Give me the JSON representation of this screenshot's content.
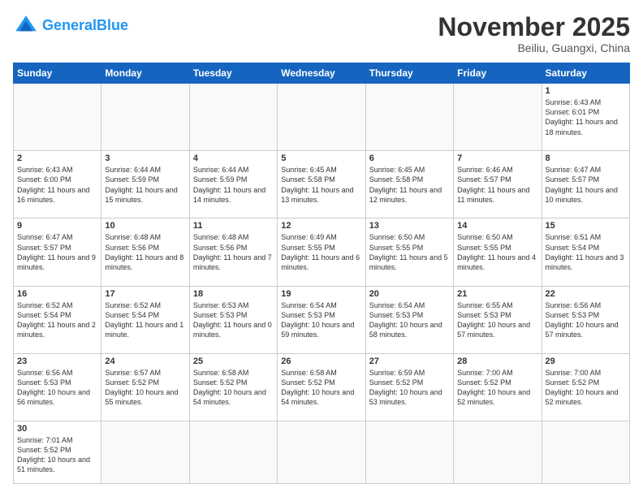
{
  "logo": {
    "text_general": "General",
    "text_blue": "Blue"
  },
  "header": {
    "month": "November 2025",
    "location": "Beiliu, Guangxi, China"
  },
  "weekdays": [
    "Sunday",
    "Monday",
    "Tuesday",
    "Wednesday",
    "Thursday",
    "Friday",
    "Saturday"
  ],
  "weeks": [
    [
      {
        "day": "",
        "info": ""
      },
      {
        "day": "",
        "info": ""
      },
      {
        "day": "",
        "info": ""
      },
      {
        "day": "",
        "info": ""
      },
      {
        "day": "",
        "info": ""
      },
      {
        "day": "",
        "info": ""
      },
      {
        "day": "1",
        "info": "Sunrise: 6:43 AM\nSunset: 6:01 PM\nDaylight: 11 hours\nand 18 minutes."
      }
    ],
    [
      {
        "day": "2",
        "info": "Sunrise: 6:43 AM\nSunset: 6:00 PM\nDaylight: 11 hours\nand 16 minutes."
      },
      {
        "day": "3",
        "info": "Sunrise: 6:44 AM\nSunset: 5:59 PM\nDaylight: 11 hours\nand 15 minutes."
      },
      {
        "day": "4",
        "info": "Sunrise: 6:44 AM\nSunset: 5:59 PM\nDaylight: 11 hours\nand 14 minutes."
      },
      {
        "day": "5",
        "info": "Sunrise: 6:45 AM\nSunset: 5:58 PM\nDaylight: 11 hours\nand 13 minutes."
      },
      {
        "day": "6",
        "info": "Sunrise: 6:45 AM\nSunset: 5:58 PM\nDaylight: 11 hours\nand 12 minutes."
      },
      {
        "day": "7",
        "info": "Sunrise: 6:46 AM\nSunset: 5:57 PM\nDaylight: 11 hours\nand 11 minutes."
      },
      {
        "day": "8",
        "info": "Sunrise: 6:47 AM\nSunset: 5:57 PM\nDaylight: 11 hours\nand 10 minutes."
      }
    ],
    [
      {
        "day": "9",
        "info": "Sunrise: 6:47 AM\nSunset: 5:57 PM\nDaylight: 11 hours\nand 9 minutes."
      },
      {
        "day": "10",
        "info": "Sunrise: 6:48 AM\nSunset: 5:56 PM\nDaylight: 11 hours\nand 8 minutes."
      },
      {
        "day": "11",
        "info": "Sunrise: 6:48 AM\nSunset: 5:56 PM\nDaylight: 11 hours\nand 7 minutes."
      },
      {
        "day": "12",
        "info": "Sunrise: 6:49 AM\nSunset: 5:55 PM\nDaylight: 11 hours\nand 6 minutes."
      },
      {
        "day": "13",
        "info": "Sunrise: 6:50 AM\nSunset: 5:55 PM\nDaylight: 11 hours\nand 5 minutes."
      },
      {
        "day": "14",
        "info": "Sunrise: 6:50 AM\nSunset: 5:55 PM\nDaylight: 11 hours\nand 4 minutes."
      },
      {
        "day": "15",
        "info": "Sunrise: 6:51 AM\nSunset: 5:54 PM\nDaylight: 11 hours\nand 3 minutes."
      }
    ],
    [
      {
        "day": "16",
        "info": "Sunrise: 6:52 AM\nSunset: 5:54 PM\nDaylight: 11 hours\nand 2 minutes."
      },
      {
        "day": "17",
        "info": "Sunrise: 6:52 AM\nSunset: 5:54 PM\nDaylight: 11 hours\nand 1 minute."
      },
      {
        "day": "18",
        "info": "Sunrise: 6:53 AM\nSunset: 5:53 PM\nDaylight: 11 hours\nand 0 minutes."
      },
      {
        "day": "19",
        "info": "Sunrise: 6:54 AM\nSunset: 5:53 PM\nDaylight: 10 hours\nand 59 minutes."
      },
      {
        "day": "20",
        "info": "Sunrise: 6:54 AM\nSunset: 5:53 PM\nDaylight: 10 hours\nand 58 minutes."
      },
      {
        "day": "21",
        "info": "Sunrise: 6:55 AM\nSunset: 5:53 PM\nDaylight: 10 hours\nand 57 minutes."
      },
      {
        "day": "22",
        "info": "Sunrise: 6:56 AM\nSunset: 5:53 PM\nDaylight: 10 hours\nand 57 minutes."
      }
    ],
    [
      {
        "day": "23",
        "info": "Sunrise: 6:56 AM\nSunset: 5:53 PM\nDaylight: 10 hours\nand 56 minutes."
      },
      {
        "day": "24",
        "info": "Sunrise: 6:57 AM\nSunset: 5:52 PM\nDaylight: 10 hours\nand 55 minutes."
      },
      {
        "day": "25",
        "info": "Sunrise: 6:58 AM\nSunset: 5:52 PM\nDaylight: 10 hours\nand 54 minutes."
      },
      {
        "day": "26",
        "info": "Sunrise: 6:58 AM\nSunset: 5:52 PM\nDaylight: 10 hours\nand 54 minutes."
      },
      {
        "day": "27",
        "info": "Sunrise: 6:59 AM\nSunset: 5:52 PM\nDaylight: 10 hours\nand 53 minutes."
      },
      {
        "day": "28",
        "info": "Sunrise: 7:00 AM\nSunset: 5:52 PM\nDaylight: 10 hours\nand 52 minutes."
      },
      {
        "day": "29",
        "info": "Sunrise: 7:00 AM\nSunset: 5:52 PM\nDaylight: 10 hours\nand 52 minutes."
      }
    ],
    [
      {
        "day": "30",
        "info": "Sunrise: 7:01 AM\nSunset: 5:52 PM\nDaylight: 10 hours\nand 51 minutes."
      },
      {
        "day": "",
        "info": ""
      },
      {
        "day": "",
        "info": ""
      },
      {
        "day": "",
        "info": ""
      },
      {
        "day": "",
        "info": ""
      },
      {
        "day": "",
        "info": ""
      },
      {
        "day": "",
        "info": ""
      }
    ]
  ]
}
